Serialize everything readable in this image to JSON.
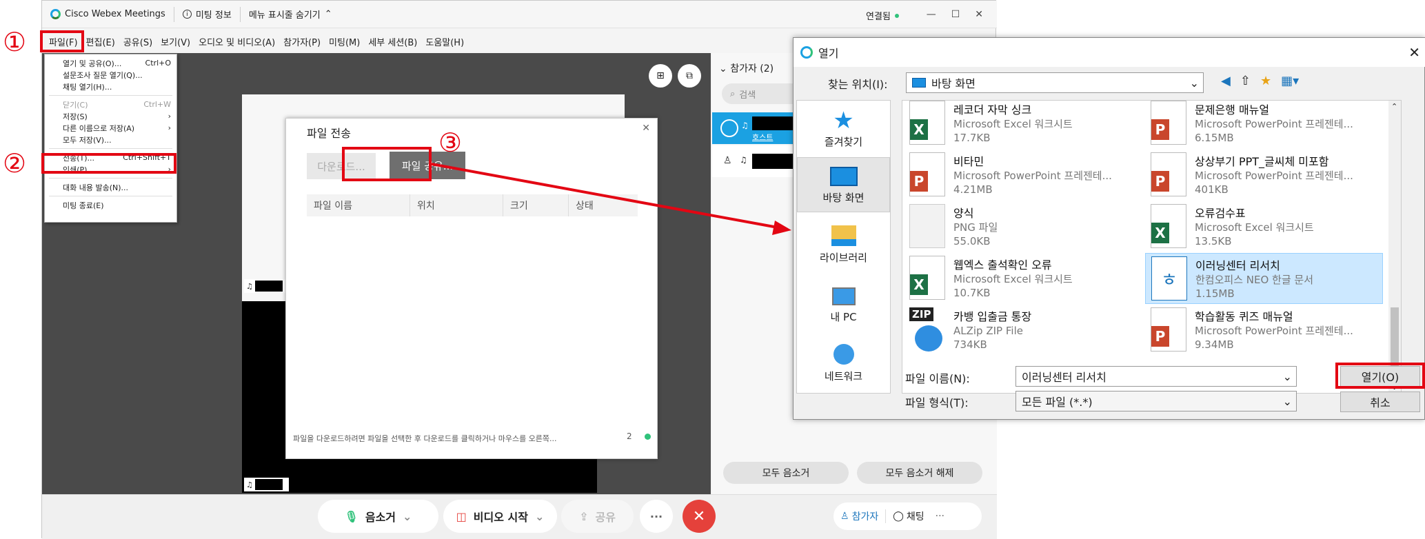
{
  "webex": {
    "app_name": "Cisco Webex Meetings",
    "meeting_info": "미팅 정보",
    "menu_toggle": "메뉴 표시줄 숨기기",
    "connection_status": "연결됨",
    "menus": [
      "파일(F)",
      "편집(E)",
      "공유(S)",
      "보기(V)",
      "오디오 및 비디오(A)",
      "참가자(P)",
      "미팅(M)",
      "세부 세션(B)",
      "도움말(H)"
    ],
    "file_menu": {
      "items": [
        {
          "label": "열기 및 공유(O)...",
          "shortcut": "Ctrl+O"
        },
        {
          "label": "설문조사 질문 열기(Q)...",
          "shortcut": ""
        },
        {
          "label": "채팅 열기(H)...",
          "shortcut": ""
        },
        {
          "label": "닫기(C)",
          "shortcut": "Ctrl+W"
        },
        {
          "label": "저장(S)",
          "shortcut": "›"
        },
        {
          "label": "다른 이름으로 저장(A)",
          "shortcut": "›"
        },
        {
          "label": "모두 저장(V)...",
          "shortcut": ""
        },
        {
          "label": "전송(T)...",
          "shortcut": "Ctrl+Shift+T"
        },
        {
          "label": "인쇄(P)",
          "shortcut": "›"
        },
        {
          "label": "대화 내용 발송(N)...",
          "shortcut": ""
        },
        {
          "label": "미팅 종료(E)",
          "shortcut": ""
        }
      ]
    },
    "file_transfer": {
      "title": "파일 전송",
      "download_button": "다운로드...",
      "share_button": "파일 공유...",
      "columns": [
        "파일 이름",
        "위치",
        "크기",
        "상태"
      ],
      "footer": "파일을 다운로드하려면 파일을 선택한 후 다운로드를 클릭하거나 마우스를 오른쪽...",
      "count": "2"
    },
    "participants": {
      "header": "참가자 (2)",
      "search_placeholder": "검색",
      "host_label": "호스트",
      "mute_all": "모두 음소거",
      "unmute_all": "모두 음소거 해제"
    },
    "controls": {
      "mute": "음소거",
      "start_video": "비디오 시작",
      "share": "공유",
      "more": "···",
      "participants": "참가자",
      "chat": "채팅"
    }
  },
  "open_dialog": {
    "title": "열기",
    "look_in_label": "찾는 위치(I):",
    "look_in_value": "바탕 화면",
    "places": [
      "즐겨찾기",
      "바탕 화면",
      "라이브러리",
      "내 PC",
      "네트워크"
    ],
    "files": [
      {
        "name": "레코더 자막 싱크",
        "type": "Microsoft Excel 워크시트",
        "size": "17.7KB",
        "icon": "excel-icon"
      },
      {
        "name": "문제은행 매뉴얼",
        "type": "Microsoft PowerPoint 프레젠테...",
        "size": "6.15MB",
        "icon": "powerpoint-icon"
      },
      {
        "name": "비타민",
        "type": "Microsoft PowerPoint 프레젠테...",
        "size": "4.21MB",
        "icon": "powerpoint-thumb-icon"
      },
      {
        "name": "상상부기 PPT_글씨체 미포함",
        "type": "Microsoft PowerPoint 프레젠테...",
        "size": "401KB",
        "icon": "powerpoint-thumb-icon"
      },
      {
        "name": "양식",
        "type": "PNG 파일",
        "size": "55.0KB",
        "icon": "png-icon"
      },
      {
        "name": "오류검수표",
        "type": "Microsoft Excel 워크시트",
        "size": "13.5KB",
        "icon": "excel-icon"
      },
      {
        "name": "웹엑스 출석확인 오류",
        "type": "Microsoft Excel 워크시트",
        "size": "10.7KB",
        "icon": "excel-icon"
      },
      {
        "name": "이러닝센터 리서치",
        "type": "한컴오피스 NEO 한글 문서",
        "size": "1.15MB",
        "icon": "hwp-icon"
      },
      {
        "name": "카뱅 입출금 통장",
        "type": "ALZip ZIP File",
        "size": "734KB",
        "icon": "zip-icon"
      },
      {
        "name": "학습활동 퀴즈 매뉴얼",
        "type": "Microsoft PowerPoint 프레젠테...",
        "size": "9.34MB",
        "icon": "powerpoint-icon"
      }
    ],
    "filename_label": "파일 이름(N):",
    "filename_value": "이러닝센터 리서치",
    "filetype_label": "파일 형식(T):",
    "filetype_value": "모든 파일 (*.*)",
    "open_button": "열기(O)",
    "cancel_button": "취소"
  },
  "annotations": {
    "step1": "①",
    "step2": "②",
    "step3": "③"
  },
  "colors": {
    "highlight_red": "#e30613",
    "connected_green": "#30c27b",
    "end_red": "#e5413b",
    "selected_blue": "#cce8ff"
  }
}
